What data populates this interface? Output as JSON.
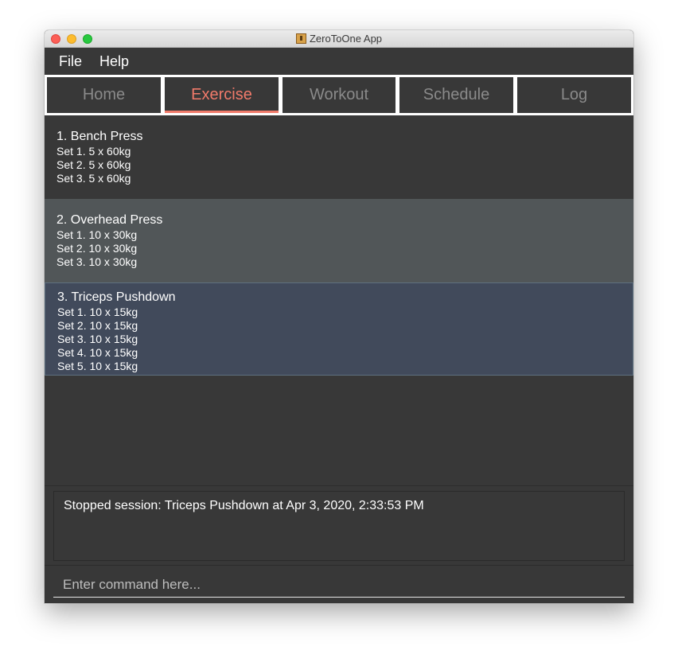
{
  "window": {
    "title": "ZeroToOne App"
  },
  "menu": {
    "file": "File",
    "help": "Help"
  },
  "tabs": [
    {
      "label": "Home"
    },
    {
      "label": "Exercise"
    },
    {
      "label": "Workout"
    },
    {
      "label": "Schedule"
    },
    {
      "label": "Log"
    }
  ],
  "active_tab": "Exercise",
  "exercises": [
    {
      "title": "1.  Bench Press",
      "sets": [
        "Set 1. 5 x 60kg",
        "Set 2. 5 x 60kg",
        "Set 3. 5 x 60kg"
      ]
    },
    {
      "title": "2.  Overhead Press",
      "sets": [
        "Set 1. 10 x 30kg",
        "Set 2. 10 x 30kg",
        "Set 3. 10 x 30kg"
      ]
    },
    {
      "title": "3.  Triceps Pushdown",
      "sets": [
        "Set 1. 10 x 15kg",
        "Set 2. 10 x 15kg",
        "Set 3. 10 x 15kg",
        "Set 4. 10 x 15kg",
        "Set 5. 10 x 15kg"
      ]
    }
  ],
  "result": {
    "message": "Stopped session: Triceps Pushdown at Apr 3, 2020, 2:33:53 PM"
  },
  "command": {
    "placeholder": "Enter command here...",
    "value": ""
  },
  "colors": {
    "accent": "#f07a6a",
    "background": "#383838",
    "selected_row": "#414a5b",
    "hover_row": "#515658"
  },
  "icons": {
    "app": "app-icon"
  }
}
